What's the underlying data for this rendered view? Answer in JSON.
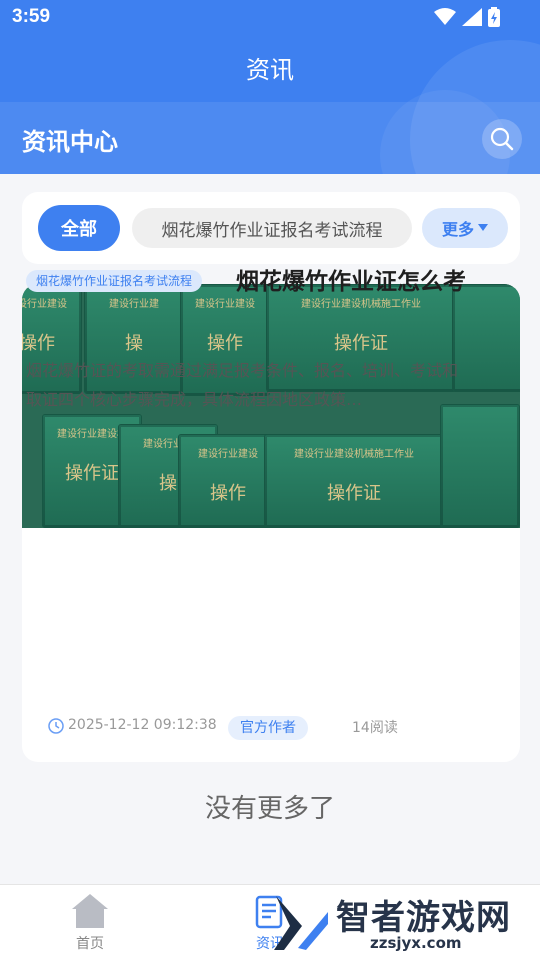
{
  "status_bar": {
    "time": "3:59"
  },
  "app_bar": {
    "title": "资讯"
  },
  "banner": {
    "title": "资讯中心"
  },
  "tabs": {
    "all": "全部",
    "category": "烟花爆竹作业证报名考试流程",
    "more": "更多"
  },
  "article": {
    "tag": "烟花爆竹作业证报名考试流程",
    "title": "烟花爆竹作业证怎么考",
    "summary": "烟花爆竹证的考取需通过满足报考条件、报名、培训、考试和取证四个核心步骤完成，具体流程因地区政策…",
    "date": "2025-12-12 09:12:38",
    "author": "官方作者",
    "reads": "14阅读",
    "image": {
      "books": [
        {
          "small": "建设行业建设",
          "big": "操作"
        },
        {
          "small": "建设行业建",
          "big": "操"
        },
        {
          "small": "建设行业建设",
          "big": "操作"
        },
        {
          "small": "建设行业建设机械施工作业",
          "big": "操作证"
        },
        {
          "small": "建设行业建设机",
          "big": "操作证"
        },
        {
          "small": "建设行业建设",
          "big": "操作"
        },
        {
          "small": "建设行业建设机械施工作业",
          "big": "操作证"
        }
      ]
    }
  },
  "footer_text": "没有更多了",
  "bottom_nav": {
    "home": "首页",
    "news": "资讯"
  },
  "watermark": {
    "name": "智者游戏网",
    "url": "zzsjyx.com"
  },
  "colors": {
    "primary": "#3e80f0",
    "tag_bg": "#dbe8fc"
  }
}
